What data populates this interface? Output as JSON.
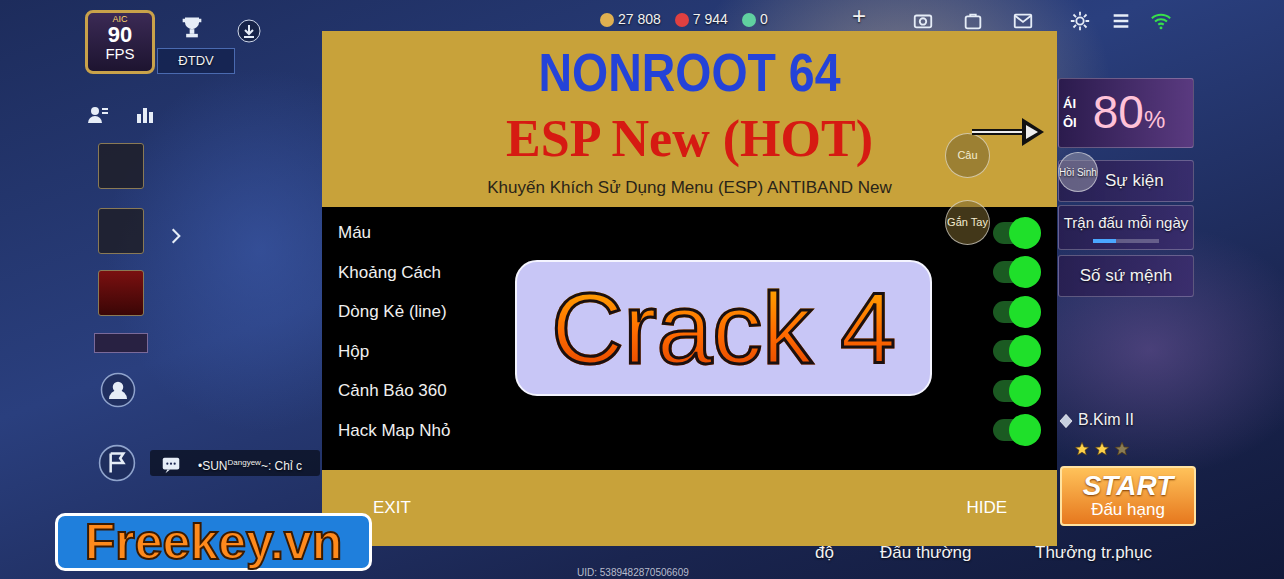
{
  "hud": {
    "badge": "AIC",
    "fps": "90",
    "fps_label": "FPS",
    "team": "ĐTDV",
    "currencies": [
      {
        "amount": "27 808",
        "color": "#e0b050"
      },
      {
        "amount": "7 944",
        "color": "#e04040"
      },
      {
        "amount": "0",
        "color": "#60d0a0"
      }
    ],
    "add": "+"
  },
  "chat": {
    "prefix": "•SUN",
    "superscript": "Dangyew",
    "text": "~: Chỉ c"
  },
  "menu": {
    "title": "NONROOT 64",
    "subtitle": "ESP New (HOT)",
    "note": "Khuyến Khích Sử Dụng Menu (ESP) ANTIBAND New",
    "options": [
      {
        "label": "Máu",
        "on": true
      },
      {
        "label": "Khoảng Cách",
        "on": true
      },
      {
        "label": "Dòng Kẻ (line)",
        "on": true
      },
      {
        "label": "Hộp",
        "on": true
      },
      {
        "label": "Cảnh Báo 360",
        "on": true
      },
      {
        "label": "Hack Map Nhỏ",
        "on": true
      }
    ],
    "exit": "EXIT",
    "hide": "HIDE"
  },
  "stamp": "Crack 4",
  "floating_buttons": [
    "Câu",
    "Gắn Tay"
  ],
  "right_panel": {
    "banner_side": [
      "ÁI",
      "ÔI"
    ],
    "banner_value": "80",
    "banner_unit": "%",
    "revive": "Hồi Sinh",
    "items": [
      {
        "label": "Sự kiện"
      },
      {
        "label": "Trận đấu mỗi ngày",
        "level": 0.35
      },
      {
        "label": "Số sứ mệnh"
      }
    ]
  },
  "rank": {
    "name": "B.Kim II",
    "stars": 2,
    "max_stars": 3
  },
  "start": {
    "title": "START",
    "subtitle": "Đấu hạng"
  },
  "bottom": {
    "modes": [
      "độ",
      "Đấu thường",
      "Thưởng tr.phục"
    ],
    "uid": "UID: 5389482870506609"
  },
  "watermark": "Freekey.vn"
}
